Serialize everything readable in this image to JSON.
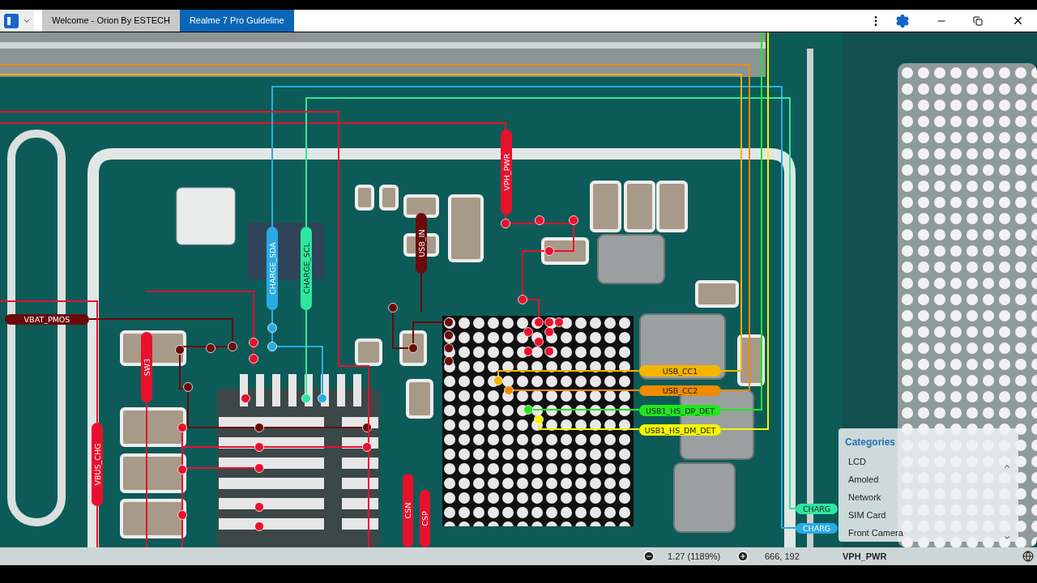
{
  "tabs": [
    {
      "label": "Welcome - Orion By ESTECH",
      "selected": false
    },
    {
      "label": "Realme 7 Pro Guideline",
      "selected": true
    }
  ],
  "net_labels": [
    {
      "text": "VPH_PWR",
      "color": "#e8112d"
    },
    {
      "text": "USB_IN",
      "color": "#6b0a0a"
    },
    {
      "text": "CHARGE_SDA",
      "color": "#29abe2"
    },
    {
      "text": "CHARGE_SCL",
      "color": "#2ee8a0"
    },
    {
      "text": "VBAT_PMOS",
      "color": "#6b0a0a"
    },
    {
      "text": "SW3",
      "color": "#e8112d"
    },
    {
      "text": "VBUS_CHG",
      "color": "#e8112d"
    },
    {
      "text": "CSN",
      "color": "#e8112d"
    },
    {
      "text": "CSP",
      "color": "#e8112d"
    },
    {
      "text": "USB_CC1",
      "color": "#f5b400"
    },
    {
      "text": "USB_CC2",
      "color": "#f08a00"
    },
    {
      "text": "USB1_HS_DP_DET",
      "color": "#22e622"
    },
    {
      "text": "USB1_HS_DM_DET",
      "color": "#f5f500"
    },
    {
      "text": "CHARG",
      "color": "#2ee8a0"
    },
    {
      "text": "CHARG",
      "color": "#29abe2"
    }
  ],
  "categories": {
    "title": "Categories",
    "items": [
      "LCD",
      "Amoled",
      "Network",
      "SIM Card",
      "Front Camera"
    ]
  },
  "status_bar": {
    "zoom": "1.27 (1189%)",
    "cursor": "666, 192",
    "net": "VPH_PWR"
  }
}
